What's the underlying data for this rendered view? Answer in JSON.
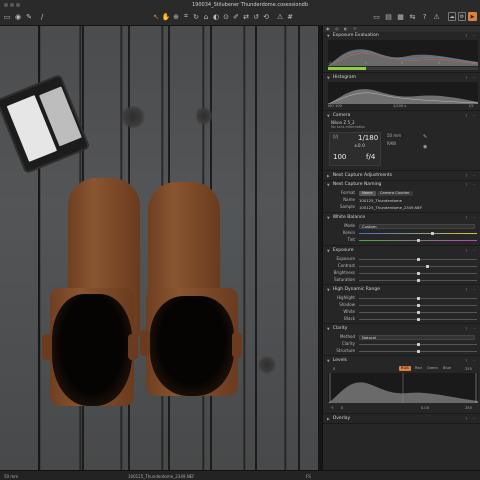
{
  "window": {
    "title": "190034_Stilubener Thunderdome.cosessiondb"
  },
  "viewer": {
    "focal_length": "50 mm",
    "filename": "100125_Thunderdome_2349.NEF",
    "iso_badge": "FS"
  },
  "panel": {
    "exposure_evaluation": {
      "title": "Exposure Evaluation",
      "scale": [
        "-2",
        "-1",
        "0",
        "1",
        "2"
      ],
      "level": 0.25
    },
    "histogram": {
      "title": "Histogram",
      "left_readout": "ISO 100",
      "mid_readout": "1/100 s",
      "right_readout": "f/2"
    },
    "camera": {
      "title": "Camera",
      "model": "Nikon Z 5_2",
      "lens": "No Lens Information",
      "shutter": "1/180",
      "ev": "±0.0",
      "iso": "100",
      "aperture": "f/4",
      "focal": "50 mm",
      "format": "RAW"
    },
    "next_capture_adjustments": {
      "title": "Next Capture Adjustments"
    },
    "next_capture_naming": {
      "title": "Next Capture Naming",
      "format_label": "Format",
      "format_chips": [
        "Name",
        "Camera Counter"
      ],
      "name_label": "Name",
      "name_value": "100125_Thunderdome",
      "sample_label": "Sample",
      "sample_value": "100125_Thunderdome_2349.NEF"
    },
    "white_balance": {
      "title": "White Balance",
      "mode_label": "Mode",
      "mode_value": "Custom",
      "kelvin_label": "Kelvin",
      "kelvin_pos": 0.62,
      "tint_label": "Tint",
      "tint_pos": 0.5
    },
    "exposure": {
      "title": "Exposure",
      "rows": [
        {
          "label": "Exposure",
          "pos": 0.5
        },
        {
          "label": "Contrast",
          "pos": 0.58
        },
        {
          "label": "Brightness",
          "pos": 0.5
        },
        {
          "label": "Saturation",
          "pos": 0.5
        }
      ]
    },
    "hdr": {
      "title": "High Dynamic Range",
      "rows": [
        {
          "label": "Highlight",
          "pos": 0.5
        },
        {
          "label": "Shadow",
          "pos": 0.5
        },
        {
          "label": "White",
          "pos": 0.5
        },
        {
          "label": "Black",
          "pos": 0.5
        }
      ]
    },
    "clarity": {
      "title": "Clarity",
      "method_label": "Method",
      "method_value": "Natural",
      "rows": [
        {
          "label": "Clarity",
          "pos": 0.5
        },
        {
          "label": "Structure",
          "pos": 0.5
        }
      ]
    },
    "levels": {
      "title": "Levels",
      "tabs": [
        "RGB",
        "Red",
        "Green",
        "Blue"
      ],
      "active_tab": "RGB",
      "left_value": "0",
      "right_value": "255",
      "input_low": "0",
      "midtone": "0.00",
      "input_high": "255"
    },
    "overlay": {
      "title": "Overlay"
    }
  }
}
